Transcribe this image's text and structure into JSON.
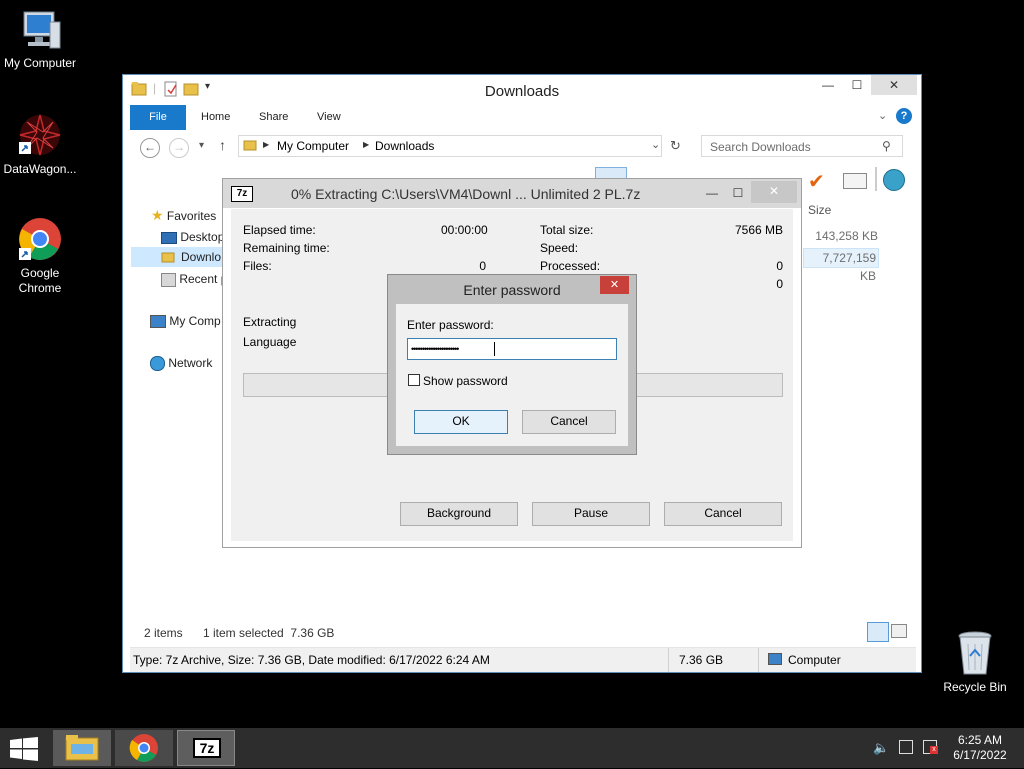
{
  "desktop": {
    "icons": [
      {
        "label": "My Computer"
      },
      {
        "label": "DataWagon..."
      },
      {
        "label": "Google Chrome"
      },
      {
        "label": "Recycle Bin"
      }
    ]
  },
  "explorer": {
    "title": "Downloads",
    "ribbon": {
      "file": "File",
      "home": "Home",
      "share": "Share",
      "view": "View"
    },
    "breadcrumb": [
      "My Computer",
      "Downloads"
    ],
    "search_placeholder": "Search Downloads",
    "nav": {
      "favorites": "Favorites",
      "desktop": "Desktop",
      "downloads": "Downlo",
      "recent": "Recent p",
      "my_computer": "My Comp",
      "network": "Network"
    },
    "columns": {
      "size": "Size"
    },
    "rows": [
      {
        "size": "143,258 KB"
      },
      {
        "size": "7,727,159 KB"
      }
    ],
    "status": {
      "items": "2 items",
      "selected": "1 item selected",
      "selected_size": "7.36 GB"
    },
    "details_bar": {
      "info": "Type: 7z Archive, Size: 7.36 GB, Date modified: 6/17/2022 6:24 AM",
      "size": "7.36 GB",
      "location": "Computer"
    }
  },
  "extract_dialog": {
    "title": "0% Extracting C:\\Users\\VM4\\Downl ...  Unlimited 2 PL.7z",
    "app_icon": "7z",
    "elapsed_label": "Elapsed time:",
    "elapsed_value": "00:00:00",
    "remaining_label": "Remaining time:",
    "files_label": "Files:",
    "files_value": "0",
    "total_size_label": "Total size:",
    "total_size_value": "7566 MB",
    "speed_label": "Speed:",
    "processed_label": "Processed:",
    "processed_value": "0",
    "extra_value": "0",
    "extracting_label": "Extracting",
    "language_label": "Language",
    "progress": 0,
    "buttons": {
      "background": "Background",
      "pause": "Pause",
      "cancel": "Cancel"
    }
  },
  "password_dialog": {
    "title": "Enter password",
    "prompt": "Enter password:",
    "value": "••••••••••••••••••••••",
    "show_password": "Show password",
    "ok": "OK",
    "cancel": "Cancel"
  },
  "taskbar": {
    "time": "6:25 AM",
    "date": "6/17/2022",
    "seven_zip_label": "7z"
  },
  "colors": {
    "accent": "#1979ca",
    "taskbar": "#2d2d2d",
    "close": "#c7403a"
  }
}
